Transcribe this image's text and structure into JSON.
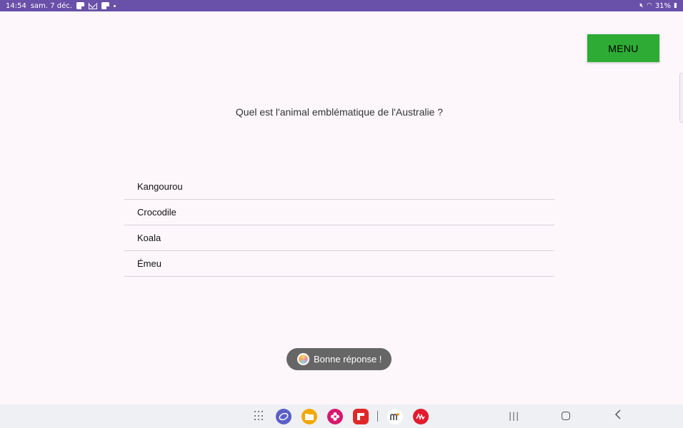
{
  "status_bar": {
    "time": "14:54",
    "date": "sam. 7 déc.",
    "notification_icons": [
      "flipboard-icon",
      "gmail-icon",
      "flipboard-icon",
      "dot-icon"
    ],
    "battery": "31%"
  },
  "header": {
    "menu_label": "MENU",
    "menu_color": "#2eab35"
  },
  "quiz": {
    "question": "Quel est l'animal emblématique de l'Australie ?",
    "answers": [
      {
        "label": "Kangourou"
      },
      {
        "label": "Crocodile"
      },
      {
        "label": "Koala"
      },
      {
        "label": "Émeu"
      }
    ]
  },
  "toast": {
    "message": "Bonne réponse !"
  },
  "dock": {
    "apps": [
      "internet-icon",
      "files-icon",
      "gallery-icon",
      "flipboard-icon",
      "moodle-icon",
      "signature-icon"
    ]
  },
  "colors": {
    "status_bar": "#6950a8",
    "background": "#fdf7fc"
  }
}
